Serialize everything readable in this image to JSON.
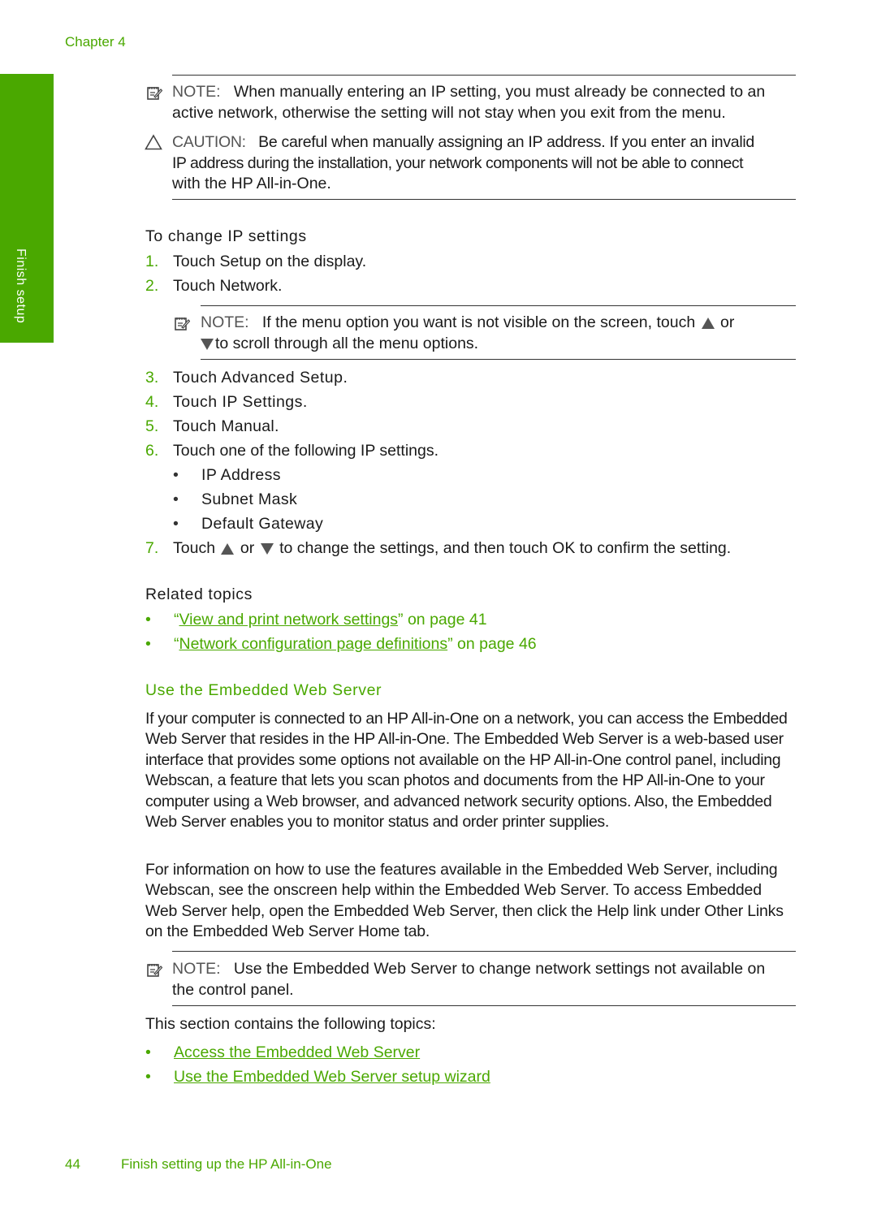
{
  "header": {
    "chapter": "Chapter 4"
  },
  "side_tab": {
    "label": "Finish setup",
    "color": "#4aa800"
  },
  "callouts_top": {
    "note": {
      "label": "NOTE:",
      "lines": [
        "When manually entering an IP setting, you must already be connected to an",
        "active network, otherwise the setting will not stay when you exit from the menu."
      ]
    },
    "caution": {
      "label": "CAUTION:",
      "lines": [
        "Be careful when manually assigning an IP address. If you enter an invalid",
        "IP address during the installation, your network components will not be able to connect",
        "with the HP All-in-One."
      ]
    }
  },
  "procedure": {
    "title": "To change IP settings",
    "steps": [
      {
        "num": "1.",
        "text": "Touch Setup on the display."
      },
      {
        "num": "2.",
        "text": "Touch Network."
      },
      {
        "num": "3.",
        "text": "Touch Advanced Setup."
      },
      {
        "num": "4.",
        "text": "Touch IP Settings."
      },
      {
        "num": "5.",
        "text": "Touch Manual."
      },
      {
        "num": "6.",
        "text": "Touch one of the following IP settings."
      },
      {
        "num": "7.",
        "text_before": "Touch",
        "text_mid": "or",
        "text_after": "to change the settings, and then touch OK to confirm the setting."
      }
    ],
    "note": {
      "label": "NOTE:",
      "line1": "If the menu option you want is not visible on the screen, touch",
      "line1_end": "or",
      "line2": "to scroll through all the menu options."
    },
    "ip_options": [
      "IP Address",
      "Subnet Mask",
      "Default Gateway"
    ]
  },
  "related_topics": {
    "title": "Related topics",
    "items": [
      {
        "open_quote": "“",
        "link": "View and print network settings",
        "suffix": "” on page 41"
      },
      {
        "open_quote": "“",
        "link": "Network configuration page definitions",
        "suffix": "” on page 46"
      }
    ]
  },
  "section": {
    "title": "Use the Embedded Web Server",
    "para1": "If your computer is connected to an HP All-in-One on a network, you can access the Embedded Web Server that resides in the HP All-in-One. The Embedded Web Server is a web-based user interface that provides some options not available on the HP All-in-One control panel, including Webscan, a feature that lets you scan photos and documents from the HP All-in-One to your computer using a Web browser, and advanced network security options. Also, the Embedded Web Server enables you to monitor status and order printer supplies.",
    "para2": "For information on how to use the features available in the Embedded Web Server, including Webscan, see the onscreen help within the Embedded Web Server. To access Embedded Web Server help, open the Embedded Web Server, then click the Help link under Other Links on the Embedded Web Server Home tab.",
    "note": {
      "label": "NOTE:",
      "lines": [
        "Use the Embedded Web Server to change network settings not available on",
        "the control panel."
      ]
    },
    "topics_intro": "This section contains the following topics:",
    "topics": [
      "Access the Embedded Web Server",
      "Use the Embedded Web Server setup wizard"
    ]
  },
  "footer": {
    "page_number": "44",
    "title": "Finish setting up the HP All-in-One"
  },
  "bullet_char": "•"
}
